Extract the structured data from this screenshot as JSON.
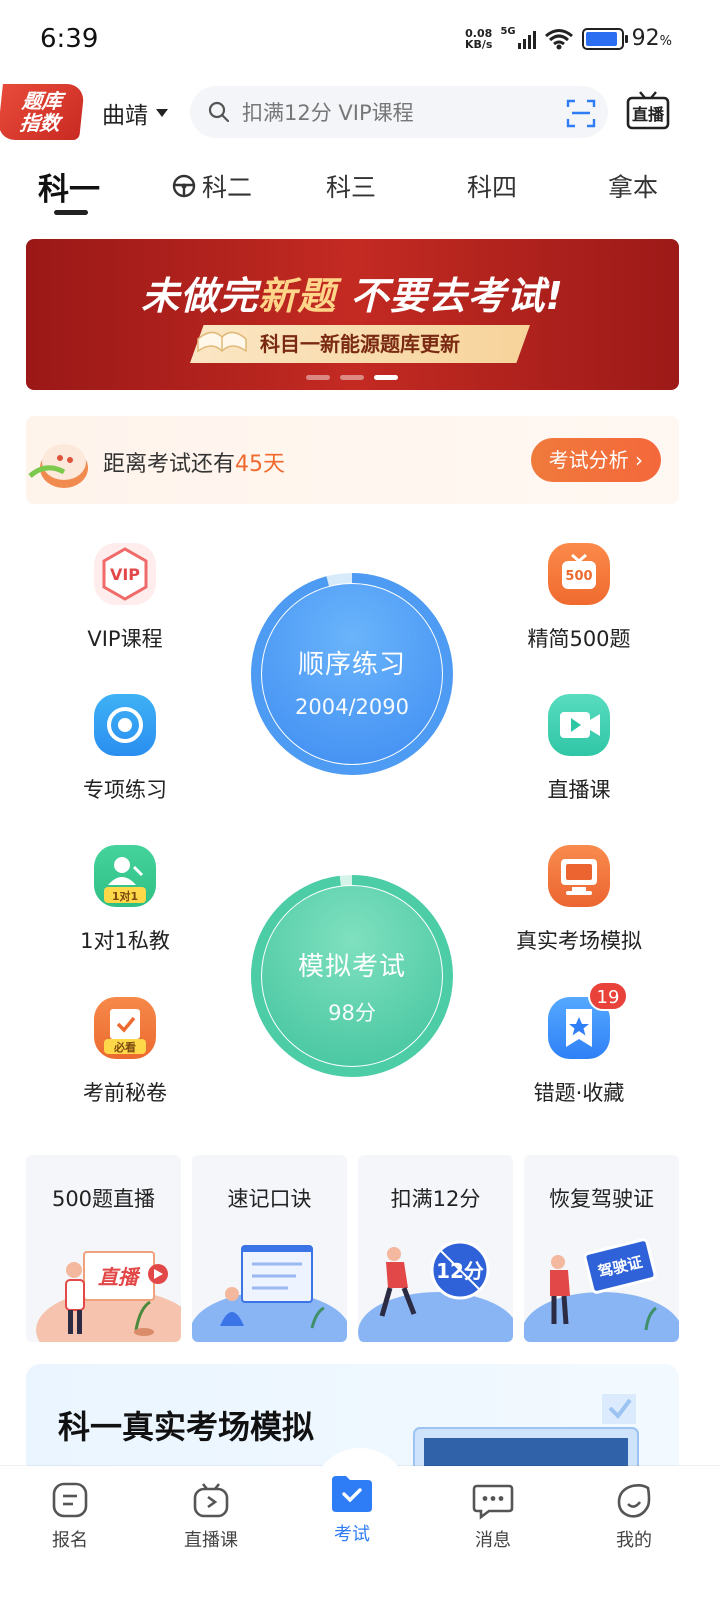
{
  "status": {
    "time": "6:39",
    "net_speed_top": "0.08",
    "net_speed_unit": "KB/s",
    "network": "5G",
    "battery_pct": "92",
    "battery_unit": "%",
    "battery_level": 0.92
  },
  "header": {
    "logo_line1": "题库",
    "logo_line2": "指数",
    "city": "曲靖",
    "search_placeholder": "扣满12分 VIP课程",
    "live_label": "直播"
  },
  "tabs": [
    {
      "label": "科一",
      "active": true
    },
    {
      "label": "科二",
      "active": false
    },
    {
      "label": "科三",
      "active": false
    },
    {
      "label": "科四",
      "active": false
    },
    {
      "label": "拿本",
      "active": false
    }
  ],
  "banner": {
    "title_pre": "未做完",
    "title_hl": "新题",
    "title_post": " 不要去考试!",
    "ribbon": "科目一新能源题库更新",
    "slides": 3,
    "active_slide": 3
  },
  "countdown": {
    "text": "距离考试还有",
    "days": "45天",
    "button": "考试分析 ›"
  },
  "features": {
    "vip": "VIP课程",
    "special": "专项练习",
    "tutor": "1对1私教",
    "secret": "考前秘卷",
    "jingjian": "精简500题",
    "live": "直播课",
    "real_exam": "真实考场模拟",
    "mistakes": "错题·收藏",
    "mistakes_badge": "19",
    "icon_vip_text": "VIP",
    "icon_500_text": "500",
    "icon_tutor_text": "1对1",
    "icon_secret_text": "必看"
  },
  "practice": {
    "label": "顺序练习",
    "progress": "2004/2090",
    "done": 2004,
    "total": 2090
  },
  "mock": {
    "label": "模拟考试",
    "score": "98分",
    "score_value": 98
  },
  "quick_cards": [
    {
      "title": "500题直播",
      "art_text": "直播"
    },
    {
      "title": "速记口诀"
    },
    {
      "title": "扣满12分",
      "art_text": "12分"
    },
    {
      "title": "恢复驾驶证",
      "art_text": "驾驶证"
    }
  ],
  "sim": {
    "title": "科一真实考场模拟"
  },
  "bottom_nav": [
    {
      "label": "报名",
      "active": false
    },
    {
      "label": "直播课",
      "active": false
    },
    {
      "label": "考试",
      "active": true
    },
    {
      "label": "消息",
      "active": false
    },
    {
      "label": "我的",
      "active": false
    }
  ],
  "colors": {
    "accent_blue": "#2f7df6",
    "orange": "#f06a2f",
    "banner_red": "#b8231f",
    "green": "#3ec9a4"
  }
}
